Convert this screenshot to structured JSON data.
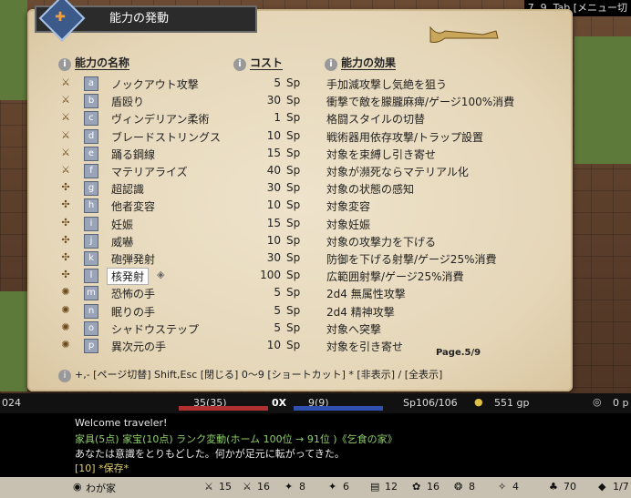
{
  "window": {
    "topright": "7 ,9 ,Tab [メニュー切"
  },
  "panel": {
    "title": "能力の発動",
    "headers": {
      "name": "能力の名称",
      "cost": "コスト",
      "effect": "能力の効果"
    },
    "page_label": "Page.5/9",
    "help": "+,- [ページ切替]  Shift,Esc [閉じる]  0～9 [ショートカット]  * [非表示]  / [全表示]"
  },
  "abilities": [
    {
      "icon": "sword-icon",
      "key": "a",
      "name": "ノックアウト攻撃",
      "cost": "5",
      "unit": "Sp",
      "effect": "手加減攻撃し気絶を狙う"
    },
    {
      "icon": "sword-icon",
      "key": "b",
      "name": "盾殴り",
      "cost": "30",
      "unit": "Sp",
      "effect": "衝撃で敵を朦朧麻痺/ゲージ100%消費"
    },
    {
      "icon": "sword-icon",
      "key": "c",
      "name": "ヴィンデリアン柔術",
      "cost": "1",
      "unit": "Sp",
      "effect": "格闘スタイルの切替"
    },
    {
      "icon": "sword-icon",
      "key": "d",
      "name": "ブレードストリングス",
      "cost": "10",
      "unit": "Sp",
      "effect": "戦術器用依存攻撃/トラップ設置"
    },
    {
      "icon": "sword-icon",
      "key": "e",
      "name": "踊る鋼線",
      "cost": "15",
      "unit": "Sp",
      "effect": "対象を束縛し引き寄せ"
    },
    {
      "icon": "sword-icon",
      "key": "f",
      "name": "マテリアライズ",
      "cost": "40",
      "unit": "Sp",
      "effect": "対象が瀕死ならマテリアル化"
    },
    {
      "icon": "plant-icon",
      "key": "g",
      "name": "超認識",
      "cost": "30",
      "unit": "Sp",
      "effect": "対象の状態の感知"
    },
    {
      "icon": "plant-icon",
      "key": "h",
      "name": "他者変容",
      "cost": "10",
      "unit": "Sp",
      "effect": "対象変容"
    },
    {
      "icon": "plant-icon",
      "key": "i",
      "name": "妊娠",
      "cost": "15",
      "unit": "Sp",
      "effect": "対象妊娠"
    },
    {
      "icon": "plant-icon",
      "key": "j",
      "name": "威嚇",
      "cost": "10",
      "unit": "Sp",
      "effect": "対象の攻撃力を下げる"
    },
    {
      "icon": "plant-icon",
      "key": "k",
      "name": "砲弾発射",
      "cost": "30",
      "unit": "Sp",
      "effect": "防御を下げる射撃/ゲージ25%消費"
    },
    {
      "icon": "plant-icon",
      "key": "l",
      "name": "核発射",
      "cost": "100",
      "unit": "Sp",
      "effect": "広範囲射撃/ゲージ25%消費",
      "selected": true
    },
    {
      "icon": "star-icon",
      "key": "m",
      "name": "恐怖の手",
      "cost": "5",
      "unit": "Sp",
      "effect": "2d4 無属性攻撃"
    },
    {
      "icon": "star-icon",
      "key": "n",
      "name": "眠りの手",
      "cost": "5",
      "unit": "Sp",
      "effect": "2d4 精神攻撃"
    },
    {
      "icon": "star-icon",
      "key": "o",
      "name": "シャドウステップ",
      "cost": "5",
      "unit": "Sp",
      "effect": "対象へ突撃"
    },
    {
      "icon": "star-icon",
      "key": "p",
      "name": "異次元の手",
      "cost": "10",
      "unit": "Sp",
      "effect": "対象を引き寄せ"
    }
  ],
  "status": {
    "left": "024",
    "hp": "35(35)",
    "sep": "0X",
    "mp": "9(9)",
    "sp": "Sp106/106",
    "gold": "551 gp",
    "right": "0 p"
  },
  "messages": {
    "line1": "Welcome traveler!",
    "line2": "家具(5点) 家宝(10点) ランク変動(ホーム 100位 → 91位 )《乞食の家》",
    "line3": "あなたは意識をとりもどした。何かが足元に転がってきた。",
    "line4": "[10]  *保存*"
  },
  "bottom": {
    "location": "わが家",
    "s1": "15",
    "s2": "16",
    "s3": "8",
    "s4": "6",
    "s5": "12",
    "s6": "16",
    "s7": "8",
    "s8": "4",
    "s9": "70",
    "s10": "1/7"
  },
  "colors": {
    "msg_green": "#8fcf6a",
    "msg_yellow": "#e0d070",
    "msg_white": "#e8e8e8"
  }
}
